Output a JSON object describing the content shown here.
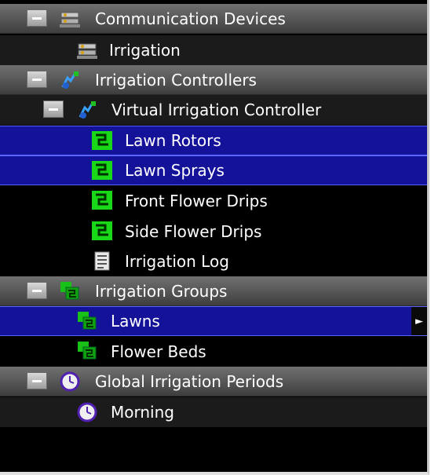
{
  "tree": {
    "sections": {
      "communication": {
        "label": "Communication Devices",
        "icon": "device-icon",
        "child": {
          "label": "Irrigation",
          "icon": "device-icon"
        }
      },
      "controllers": {
        "label": "Irrigation Controllers",
        "icon": "controller-icon"
      },
      "virtual_controller": {
        "label": "Virtual Irrigation Controller",
        "icon": "controller-icon"
      },
      "zones": [
        {
          "label": "Lawn Rotors",
          "icon": "zone-icon",
          "selected": true
        },
        {
          "label": "Lawn Sprays",
          "icon": "zone-icon",
          "selected": true
        },
        {
          "label": "Front Flower Drips",
          "icon": "zone-icon",
          "selected": false
        },
        {
          "label": "Side Flower Drips",
          "icon": "zone-icon",
          "selected": false
        }
      ],
      "log": {
        "label": "Irrigation Log",
        "icon": "log-icon"
      },
      "groups": {
        "label": "Irrigation Groups",
        "icon": "group-icon",
        "items": [
          {
            "label": "Lawns",
            "icon": "group-icon",
            "selected": true
          },
          {
            "label": "Flower Beds",
            "icon": "group-icon",
            "selected": false
          }
        ]
      },
      "periods": {
        "label": "Global Irrigation Periods",
        "icon": "clock-icon",
        "items": [
          {
            "label": "Morning",
            "icon": "clock-icon"
          }
        ]
      }
    },
    "colors": {
      "selected_bg": "#15129a",
      "zone_green": "#18d818",
      "header_gray": "#5a5a5a"
    },
    "submenu_arrow": "►"
  }
}
